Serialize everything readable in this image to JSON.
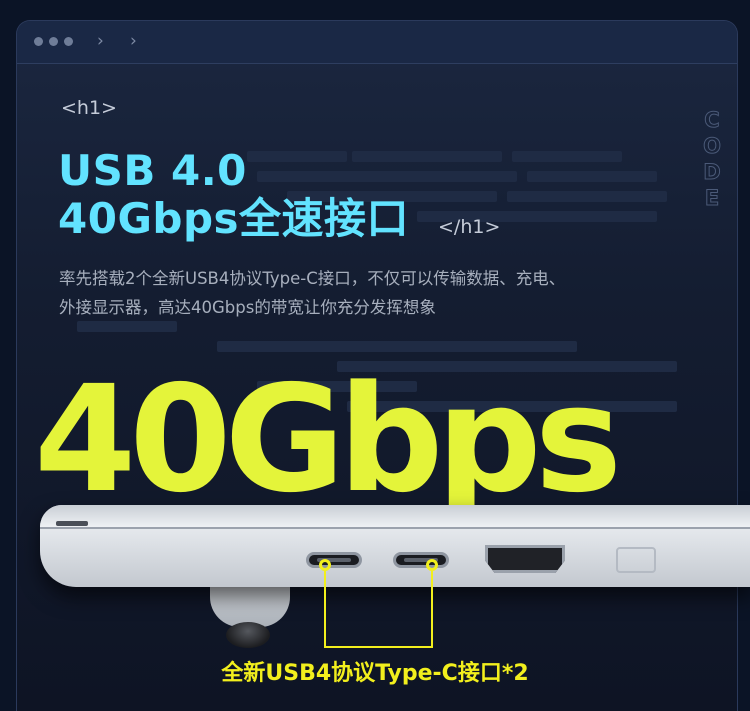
{
  "browser": {
    "dots": [
      "dot",
      "dot",
      "dot"
    ],
    "back_icon": "chevron-left-icon",
    "forward_icon": "chevron-right-icon"
  },
  "side_text": [
    "C",
    "O",
    "D",
    "E"
  ],
  "heading": {
    "open_tag": "<h1>",
    "line1": "USB 4.0",
    "line2": "40Gbps全速接口",
    "close_tag": "</h1>"
  },
  "description": {
    "line1": "率先搭载2个全新USB4协议Type-C接口，不仅可以传输数据、充电、",
    "line2": "外接显示器，高达40Gbps的带宽让你充分发挥想象"
  },
  "hero_speed": "40Gbps",
  "caption": "全新USB4协议Type-C接口*2",
  "colors": {
    "heading": "#62e3ff",
    "hero": "#e4f43a",
    "caption": "#f2ef1d",
    "background": "#0b1426"
  }
}
